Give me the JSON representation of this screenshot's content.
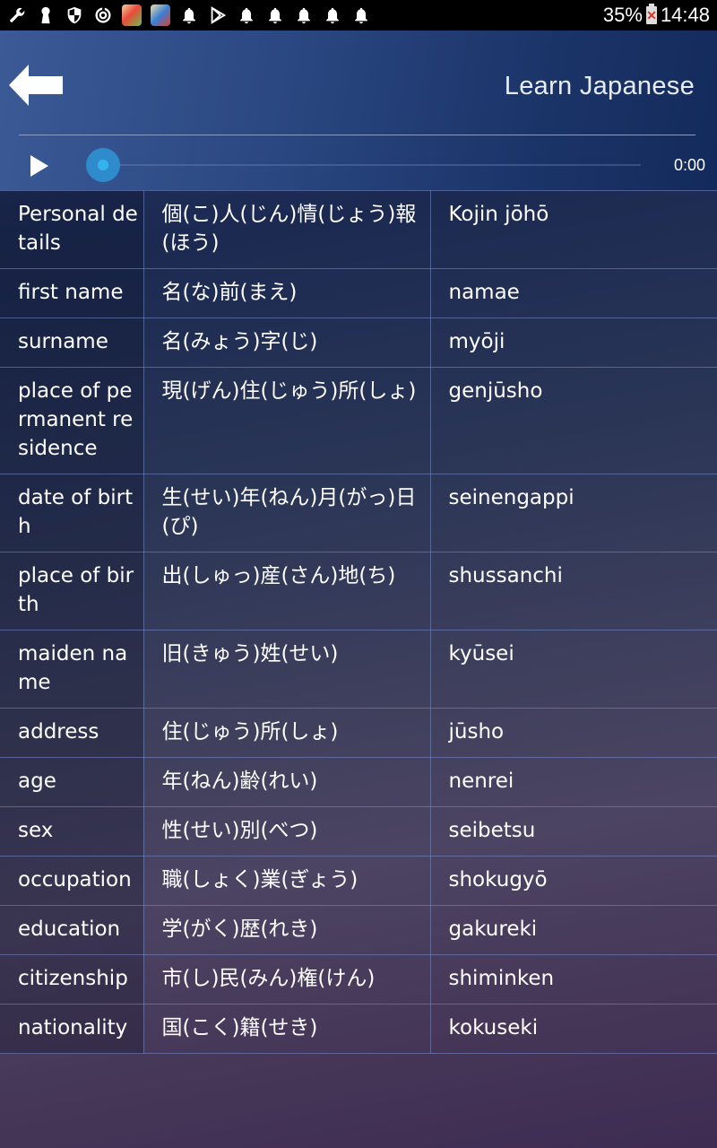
{
  "status_bar": {
    "icons": [
      "wrench-icon",
      "keyhole-icon",
      "shield-icon",
      "sync-icon",
      "game-app-icon-1",
      "game-app-icon-2",
      "bell-icon",
      "play-store-icon",
      "bell-icon",
      "bell-icon",
      "bell-icon",
      "bell-icon",
      "bell-icon"
    ],
    "battery_percent": "35%",
    "time": "14:48"
  },
  "header": {
    "title": "Learn Japanese",
    "back_icon": "arrow-left-icon"
  },
  "player": {
    "play_icon": "play-icon",
    "progress_fraction": 0,
    "time": "0:00"
  },
  "table": {
    "rows": [
      {
        "english": "Personal details",
        "japanese": "個(こ)人(じん)情(じょう)報(ほう)",
        "romaji": "Kojin jōhō"
      },
      {
        "english": "first name",
        "japanese": "名(な)前(まえ)",
        "romaji": "namae"
      },
      {
        "english": "surname",
        "japanese": "名(みょう)字(じ)",
        "romaji": "myōji"
      },
      {
        "english": "place of permanent residence",
        "japanese": "現(げん)住(じゅう)所(しょ)",
        "romaji": "genjūsho"
      },
      {
        "english": "date of birth",
        "japanese": "生(せい)年(ねん)月(がっ)日(ぴ)",
        "romaji": "seinengappi"
      },
      {
        "english": "place of birth",
        "japanese": "出(しゅっ)産(さん)地(ち)",
        "romaji": "shussanchi"
      },
      {
        "english": "maiden name",
        "japanese": "旧(きゅう)姓(せい)",
        "romaji": "kyūsei"
      },
      {
        "english": "address",
        "japanese": "住(じゅう)所(しょ)",
        "romaji": "jūsho"
      },
      {
        "english": "age",
        "japanese": "年(ねん)齢(れい)",
        "romaji": "nenrei"
      },
      {
        "english": "sex",
        "japanese": "性(せい)別(べつ)",
        "romaji": "seibetsu"
      },
      {
        "english": "occupation",
        "japanese": "職(しょく)業(ぎょう)",
        "romaji": "shokugyō"
      },
      {
        "english": "education",
        "japanese": "学(がく)歴(れき)",
        "romaji": "gakureki"
      },
      {
        "english": "citizenship",
        "japanese": "市(し)民(みん)権(けん)",
        "romaji": "shiminken"
      },
      {
        "english": "nationality",
        "japanese": "国(こく)籍(せき)",
        "romaji": "kokuseki"
      }
    ]
  },
  "colors": {
    "header_blue": "#2a4781",
    "seek_thumb": "#2f8ccc",
    "seek_thumb_center": "#34b4ee",
    "grid_line": "#7888d2"
  }
}
